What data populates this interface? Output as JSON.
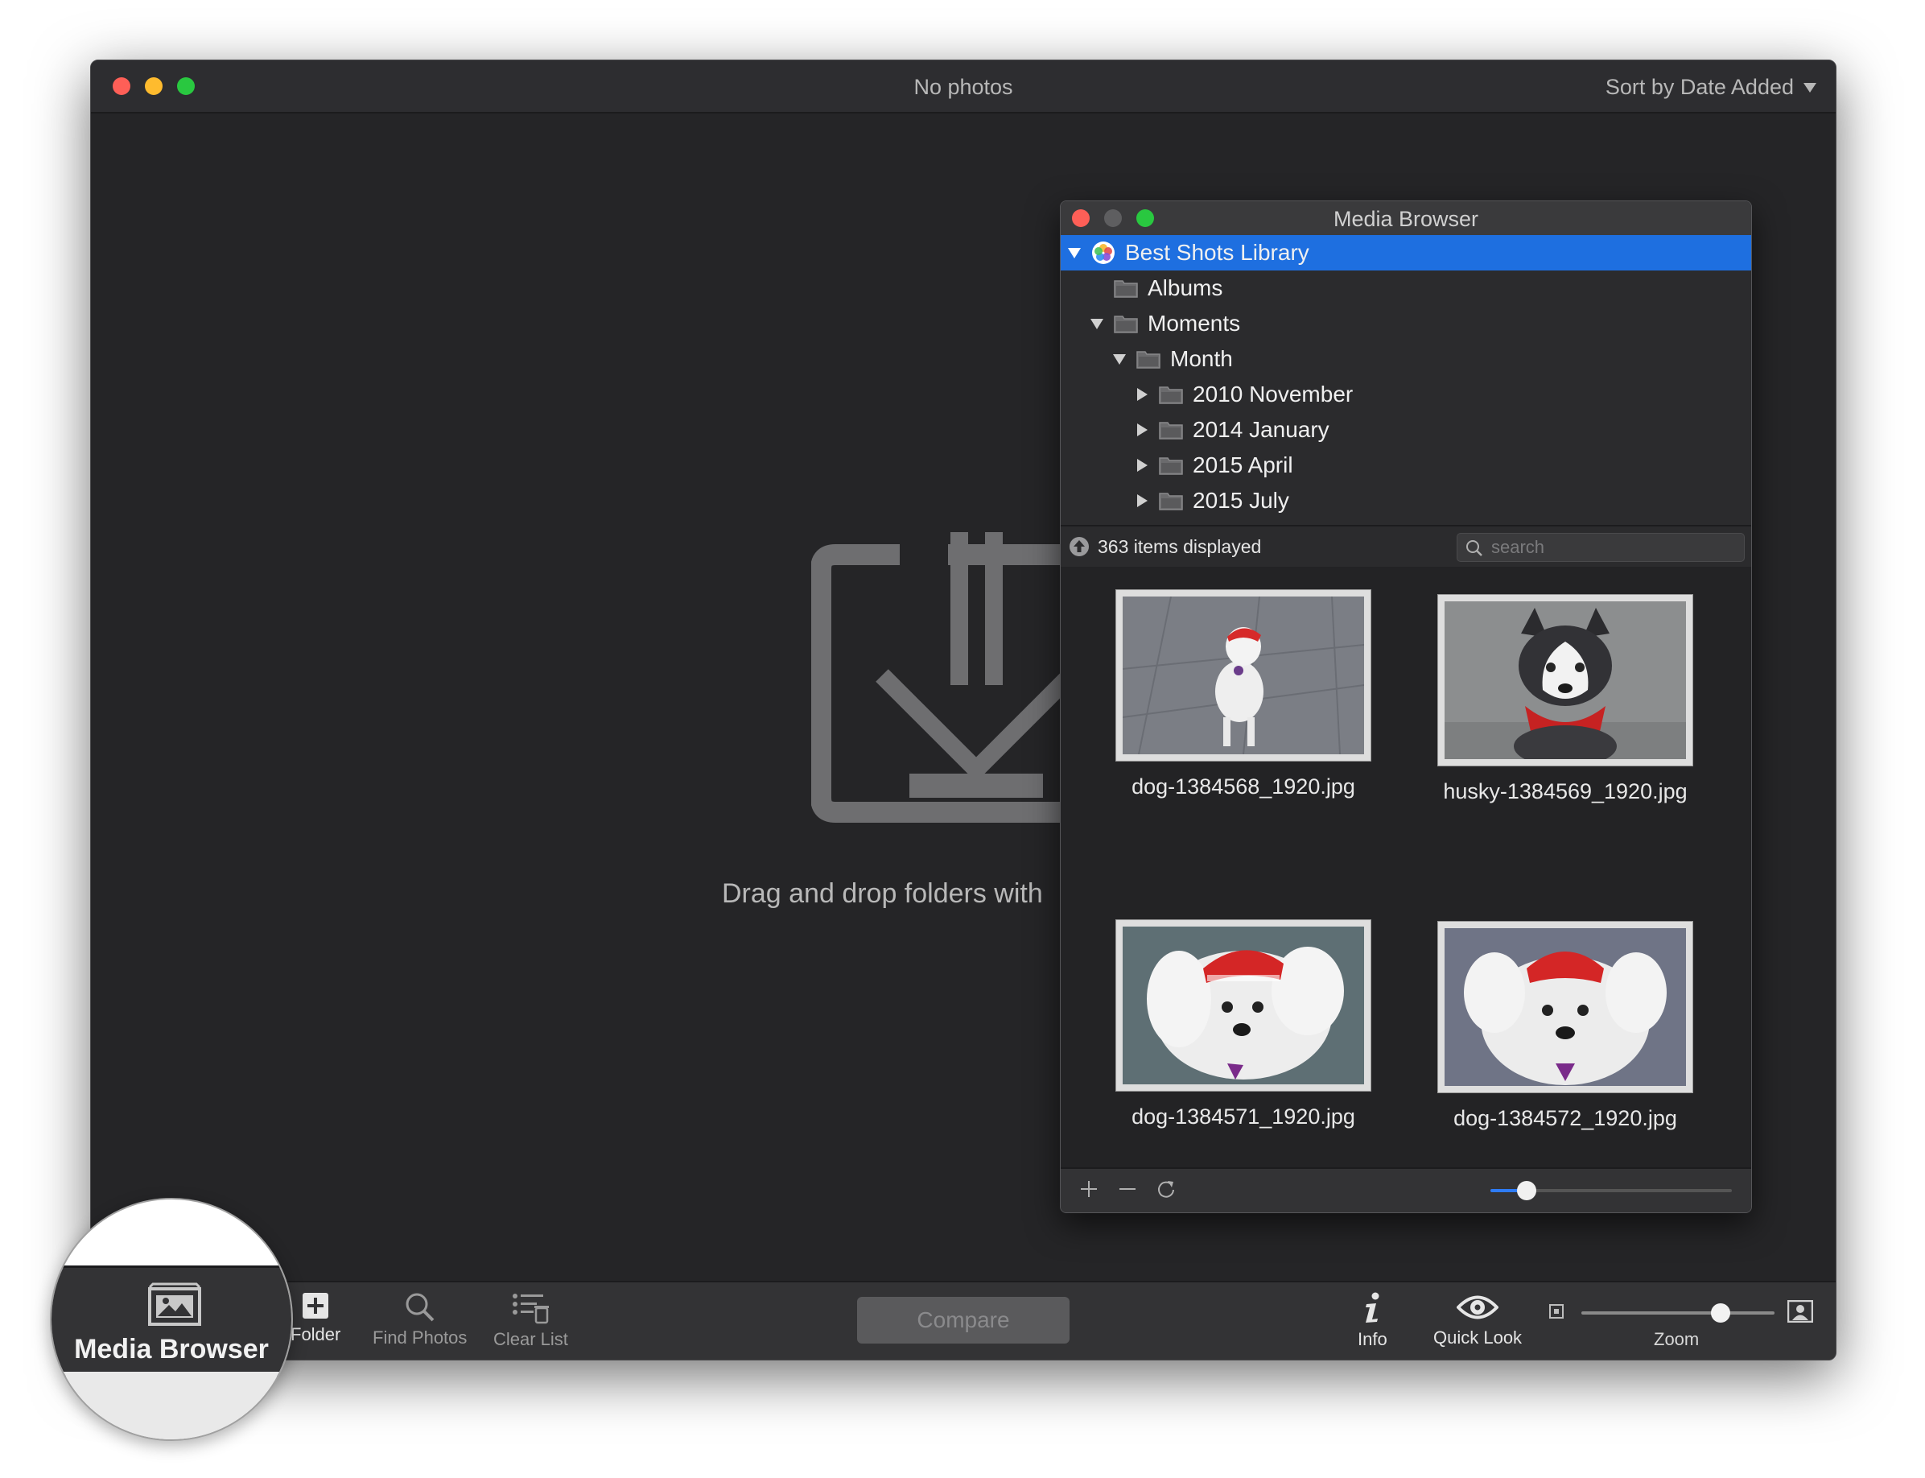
{
  "window": {
    "title": "No photos",
    "sort_label": "Sort by Date Added"
  },
  "dropzone": {
    "text": "Drag and drop folders with"
  },
  "toolbar": {
    "media_browser_label": "Media Browser",
    "add_folder_label": "Folder",
    "find_photos_label": "Find Photos",
    "clear_list_label": "Clear List",
    "compare_label": "Compare",
    "info_label": "Info",
    "quick_look_label": "Quick Look",
    "zoom_label": "Zoom",
    "zoom_level": 0.72
  },
  "media_browser": {
    "title": "Media Browser",
    "tree": [
      {
        "label": "Best Shots Library",
        "level": 0,
        "expanded": true,
        "selected": true,
        "icon": "photos-library-icon"
      },
      {
        "label": "Albums",
        "level": 1,
        "expanded": null,
        "selected": false,
        "icon": "folder-icon"
      },
      {
        "label": "Moments",
        "level": 1,
        "expanded": true,
        "selected": false,
        "icon": "folder-icon"
      },
      {
        "label": "Month",
        "level": 2,
        "expanded": true,
        "selected": false,
        "icon": "folder-icon"
      },
      {
        "label": "2010 November",
        "level": 3,
        "expanded": false,
        "selected": false,
        "icon": "folder-icon"
      },
      {
        "label": "2014 January",
        "level": 3,
        "expanded": false,
        "selected": false,
        "icon": "folder-icon"
      },
      {
        "label": "2015 April",
        "level": 3,
        "expanded": false,
        "selected": false,
        "icon": "folder-icon"
      },
      {
        "label": "2015 July",
        "level": 3,
        "expanded": false,
        "selected": false,
        "icon": "folder-icon"
      }
    ],
    "status": "363 items displayed",
    "search_placeholder": "search",
    "thumbnails": [
      {
        "filename": "dog-1384568_1920.jpg"
      },
      {
        "filename": "husky-1384569_1920.jpg"
      },
      {
        "filename": "dog-1384571_1920.jpg"
      },
      {
        "filename": "dog-1384572_1920.jpg"
      }
    ],
    "thumbnail_size": 0.15
  },
  "colors": {
    "selection": "#1e6fe0",
    "window_bg": "#252527",
    "toolbar_bg": "#333335"
  }
}
